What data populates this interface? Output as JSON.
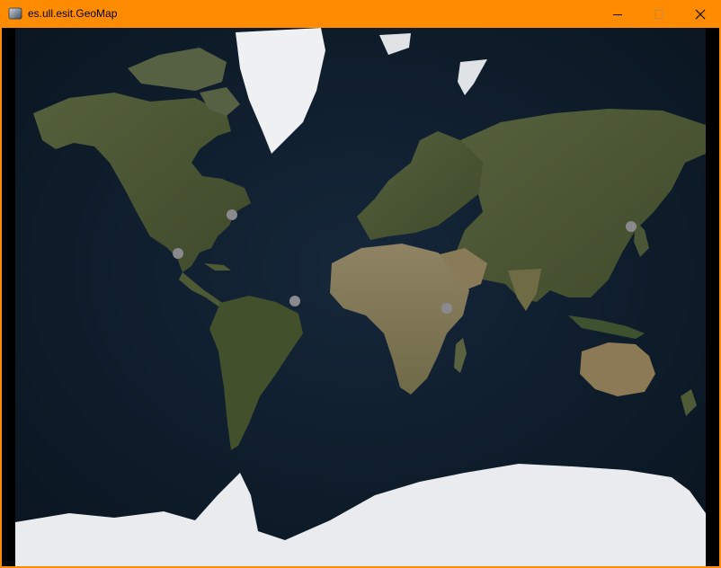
{
  "window": {
    "title": "es.ull.esit.GeoMap",
    "accent": "#ff8c00",
    "app_icon": "app-icon",
    "controls": [
      "minimize-icon",
      "maximize-icon",
      "close-icon"
    ]
  },
  "map": {
    "style": "satellite-world-mercator",
    "ocean_color": "#0d1b2a",
    "land_color": "#4f5a36",
    "ice_color": "#eaecef",
    "marker_color": "#8a8a8e",
    "markers": [
      {
        "id": "north-atlantic"
      },
      {
        "id": "gulf-of-mexico"
      },
      {
        "id": "brazil-coast"
      },
      {
        "id": "east-africa-coast"
      },
      {
        "id": "japan"
      }
    ]
  }
}
